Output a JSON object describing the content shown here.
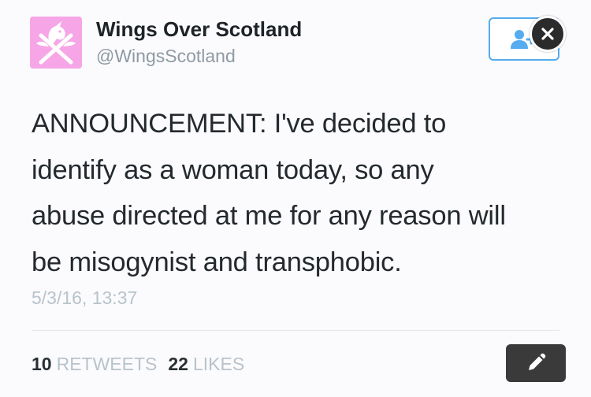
{
  "author": {
    "display_name": "Wings Over Scotland",
    "handle": "@WingsScotland",
    "avatar_icon": "unicorn-saltire-logo",
    "avatar_color": "#f6a6e6"
  },
  "actions": {
    "follow_icon": "follow-user-icon",
    "close_icon": "close-icon",
    "edit_icon": "pencil-icon",
    "accent_color": "#55acee"
  },
  "tweet": {
    "lines": [
      "ANNOUNCEMENT: I've decided to",
      "identify as a woman today, so any",
      "abuse directed at me for any reason will",
      "be misogynist and transphobic."
    ],
    "timestamp": "5/3/16, 13:37"
  },
  "stats": {
    "retweets_count": "10",
    "retweets_label": "RETWEETS",
    "likes_count": "22",
    "likes_label": "LIKES"
  }
}
